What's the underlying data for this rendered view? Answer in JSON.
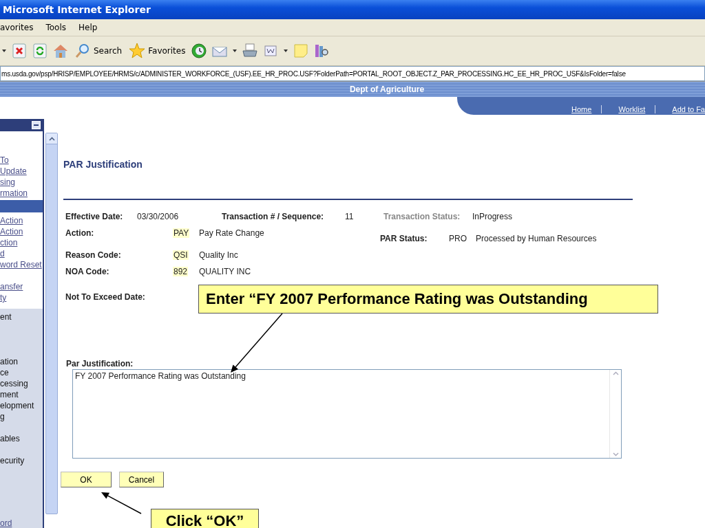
{
  "window": {
    "title": "Microsoft Internet Explorer"
  },
  "menu": [
    "avorites",
    "Tools",
    "Help"
  ],
  "toolbar": [
    {
      "kind": "dropdown"
    },
    {
      "kind": "stop"
    },
    {
      "kind": "refresh"
    },
    {
      "kind": "home"
    },
    {
      "kind": "search",
      "label": "Search"
    },
    {
      "kind": "favorites",
      "label": "Favorites"
    },
    {
      "kind": "history"
    },
    {
      "kind": "mail"
    },
    {
      "kind": "dropdown"
    },
    {
      "kind": "print"
    },
    {
      "kind": "word"
    },
    {
      "kind": "dropdown"
    },
    {
      "kind": "note"
    },
    {
      "kind": "research"
    }
  ],
  "address": "ms.usda.gov/psp/HRISP/EMPLOYEE/HRMS/c/ADMINISTER_WORKFORCE_(USF).EE_HR_PROC.USF?FolderPath=PORTAL_ROOT_OBJECT.Z_PAR_PROCESSING.HC_EE_HR_PROC_USF&IsFolder=false",
  "banner": {
    "title": "Dept of Agriculture"
  },
  "nav_links": [
    "Home",
    "Worklist",
    "Add to Fa"
  ],
  "sidebar": {
    "links_top": [
      "To",
      "Update",
      "sing",
      "rmation"
    ],
    "links_middle": [
      "Action",
      "Action",
      "ction",
      "d",
      "word Reset"
    ],
    "links_bottom": [
      "ansfer",
      "ty"
    ],
    "menu_groups": [
      [
        "ent"
      ],
      [
        "ation",
        "ce",
        "cessing",
        "ment",
        "elopment",
        "g"
      ],
      [
        "ables"
      ],
      [
        "ecurity"
      ]
    ],
    "footer_link": "ord"
  },
  "form": {
    "title": "PAR Justification",
    "effective_date": {
      "label": "Effective Date:",
      "value": "03/30/2006"
    },
    "transaction": {
      "label": "Transaction # / Sequence:",
      "value": "11"
    },
    "transaction_status": {
      "label": "Transaction Status:",
      "value": "InProgress",
      "disabled": true
    },
    "codes": [
      {
        "label": "Action:",
        "code": "PAY",
        "description": "Pay Rate Change"
      },
      {
        "label": "Reason Code:",
        "code": "QSI",
        "description": "Quality Inc"
      },
      {
        "label": "NOA Code:",
        "code": "892",
        "description": "QUALITY INC"
      }
    ],
    "par_status": {
      "label": "PAR Status:",
      "code": "PRO",
      "description": "Processed by Human Resources"
    },
    "not_to_exceed": {
      "label": "Not To Exceed Date:"
    },
    "justification": {
      "label": "Par Justification:",
      "value": "FY 2007 Performance Rating was Outstanding"
    },
    "buttons": [
      "OK",
      "Cancel"
    ]
  },
  "callouts": [
    "Enter “FY 2007 Performance Rating was Outstanding",
    "Click “OK”"
  ]
}
